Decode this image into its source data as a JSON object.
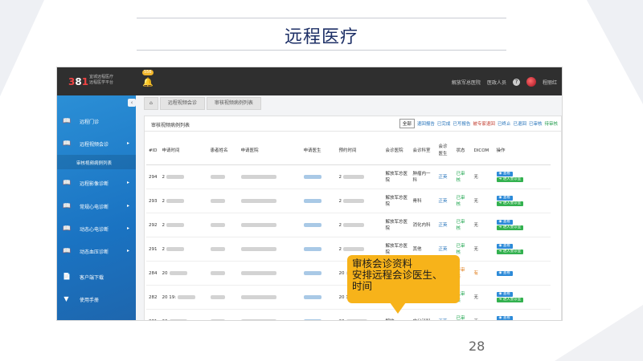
{
  "slide": {
    "title": "远程医疗",
    "page_number": "28"
  },
  "app": {
    "logo_digits": [
      "3",
      "8",
      "1"
    ],
    "logo_text_line1": "宜城远程医疗",
    "logo_text_line2": "远程医学平台",
    "notification_count": "556",
    "top_right": [
      "解放军总医院",
      "医政人员",
      "程丽红"
    ],
    "sidebar": [
      {
        "label": "远程门诊",
        "icon": "book-icon",
        "has_arrow": false
      },
      {
        "label": "远程视频会诊",
        "icon": "book-icon",
        "has_arrow": true
      },
      {
        "label": "审核视频病例列表",
        "icon": "",
        "sub": true
      },
      {
        "label": "远程影像诊断",
        "icon": "book-icon",
        "has_arrow": true
      },
      {
        "label": "常规心电诊断",
        "icon": "book-icon",
        "has_arrow": true
      },
      {
        "label": "动态心电诊断",
        "icon": "book-icon",
        "has_arrow": true
      },
      {
        "label": "动态血压诊断",
        "icon": "book-icon",
        "has_arrow": true
      },
      {
        "label": "客户端下载",
        "icon": "document-icon",
        "has_arrow": false
      },
      {
        "label": "使用手册",
        "icon": "filter-icon",
        "has_arrow": false
      }
    ],
    "breadcrumb": [
      "远程视频会诊",
      "审核视频病例列表"
    ],
    "panel_title": "审核视频病例列表",
    "filters": [
      {
        "label": "全部",
        "style": "active"
      },
      {
        "label": "退回报告",
        "style": "blue"
      },
      {
        "label": "已完成",
        "style": "blue"
      },
      {
        "label": "已写报告",
        "style": "blue"
      },
      {
        "label": "被专家退回",
        "style": "red"
      },
      {
        "label": "已终止",
        "style": "blue"
      },
      {
        "label": "已退回",
        "style": "blue"
      },
      {
        "label": "已审核",
        "style": "blue"
      },
      {
        "label": "待审核",
        "style": "green"
      }
    ],
    "columns": [
      "#ID",
      "申请时间",
      "患者姓名",
      "申请医院",
      "申请医生",
      "预约时间",
      "会诊医院",
      "会诊科室",
      "会诊医生",
      "状态",
      "DICOM",
      "操作"
    ],
    "rows": [
      {
        "id": "294",
        "time_prefix": "2",
        "hospital": "解放军总医院",
        "dept": "肿瘤内一科",
        "doctor": "正英",
        "status": "已审核",
        "status_color": "green",
        "dicom": "无",
        "actions": [
          "查看",
          "进入会诊室"
        ]
      },
      {
        "id": "293",
        "time_prefix": "2",
        "hospital": "解放军总医院",
        "dept": "骨科",
        "doctor": "正英",
        "status": "已审核",
        "status_color": "green",
        "dicom": "无",
        "actions": [
          "查看",
          "进入会诊室"
        ]
      },
      {
        "id": "292",
        "time_prefix": "2",
        "hospital": "解放军总医院",
        "dept": "消化内科",
        "doctor": "正英",
        "status": "已审核",
        "status_color": "green",
        "dicom": "无",
        "actions": [
          "查看",
          "进入会诊室"
        ]
      },
      {
        "id": "291",
        "time_prefix": "2",
        "hospital": "解放军总医院",
        "dept": "其他",
        "doctor": "正英",
        "status": "已审核",
        "status_color": "green",
        "dicom": "无",
        "actions": [
          "查看",
          "进入会诊室"
        ]
      },
      {
        "id": "284",
        "time_prefix": "20",
        "hospital": "",
        "dept": "",
        "doctor": "",
        "status": "待审核",
        "status_color": "orange",
        "dicom": "有",
        "actions": [
          "查看"
        ]
      },
      {
        "id": "282",
        "time_prefix": "20 19:",
        "hospital": "",
        "dept": "",
        "doctor": "",
        "status": "已审核",
        "status_color": "green",
        "dicom": "无",
        "actions": [
          "查看",
          "进入会诊室"
        ]
      },
      {
        "id": "281",
        "time_prefix": "20",
        "hospital": "解放",
        "dept": "内分泌科",
        "doctor": "正英",
        "status": "已审核",
        "status_color": "green",
        "dicom": "无",
        "actions": [
          "查看",
          "进入会诊室"
        ]
      }
    ]
  },
  "callout": {
    "lines": [
      "审核会诊资料",
      "安排远程会诊医生、",
      "时间"
    ]
  }
}
